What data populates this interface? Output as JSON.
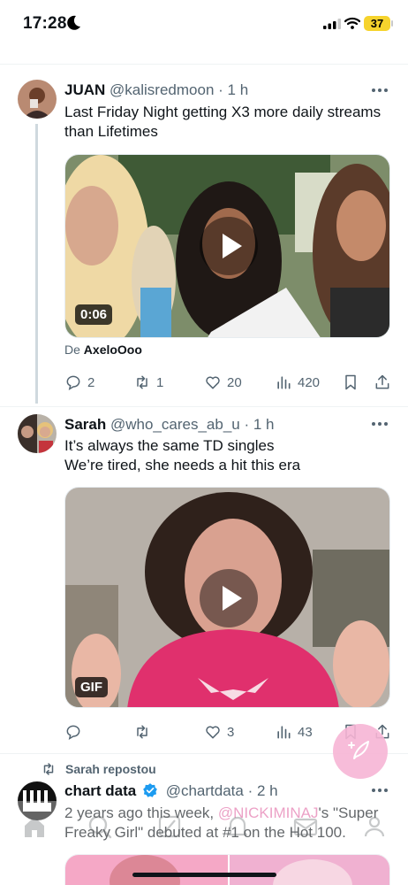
{
  "status_bar": {
    "time": "17:28",
    "battery": "37"
  },
  "tweets": [
    {
      "name": "JUAN",
      "handle": "@kalisredmoon",
      "time": "1 h",
      "text_line1": "Last Friday Night getting X3 more daily streams",
      "text_line2": "than Lifetimes",
      "video_duration": "0:06",
      "source_prefix": "De",
      "source_user": "AxeloOoo",
      "replies": "2",
      "reposts": "1",
      "likes": "20",
      "views": "420"
    },
    {
      "name": "Sarah",
      "handle": "@who_cares_ab_u",
      "time": "1 h",
      "text_line1": "It’s always the same TD singles",
      "text_line2": "We’re tired, she needs a hit this era",
      "media_badge": "GIF",
      "replies": "",
      "reposts": "",
      "likes": "3",
      "views": "43"
    },
    {
      "repost_label": "Sarah repostou",
      "name": "chart data",
      "handle": "@chartdata",
      "time": "2 h",
      "text_prefix": "2 years ago this week, ",
      "mention": "@NICKIMINAJ",
      "text_mid": "'s \"Super",
      "text_line2": "Freaky Girl\" debuted at #1 on the Hot 100."
    }
  ],
  "colors": {
    "accent": "#1d9bf0",
    "mention": "#e26fa8",
    "fab": "#f7b5d5",
    "muted": "#536471"
  },
  "icons": [
    "moon-icon",
    "signal-icon",
    "wifi-icon",
    "reply-icon",
    "repost-icon",
    "like-icon",
    "views-icon",
    "bookmark-icon",
    "share-icon",
    "more-icon",
    "play-icon",
    "verified-icon",
    "compose-icon",
    "home-icon",
    "search-icon",
    "grok-icon",
    "notifications-icon",
    "messages-icon",
    "communities-icon"
  ]
}
